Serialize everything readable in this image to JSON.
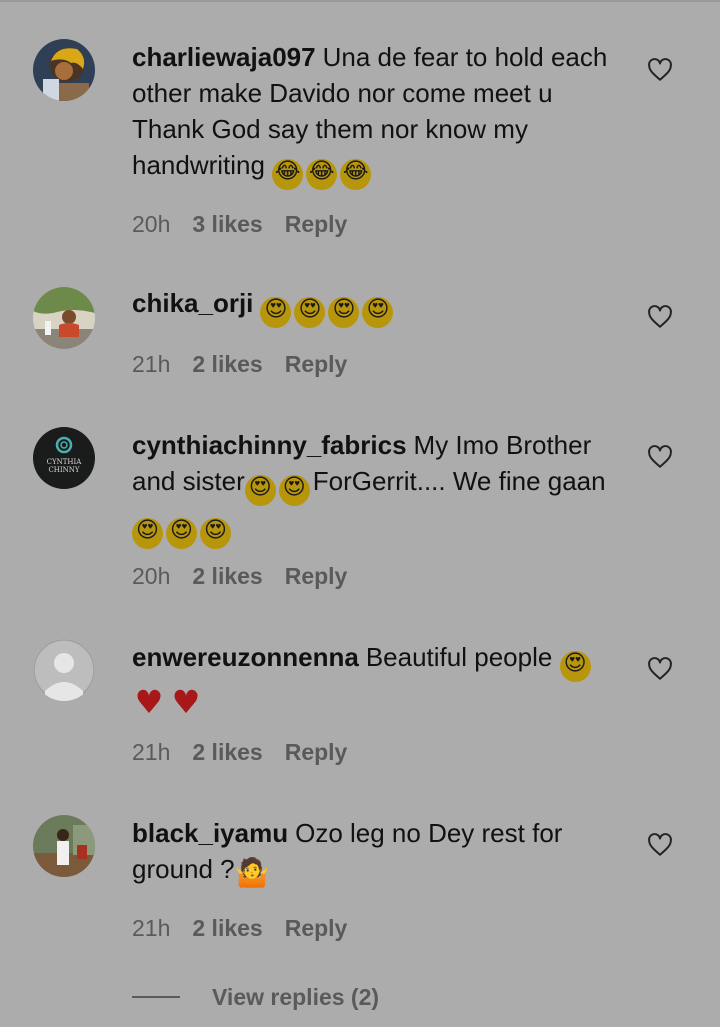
{
  "comments": [
    {
      "username": "charliewaja097",
      "text": "Una de fear to hold each other make Davido nor come meet u Thank God say them nor know my handwriting",
      "emojis": [
        "face-with-tears-of-joy",
        "face-with-tears-of-joy",
        "face-with-tears-of-joy"
      ],
      "time": "20h",
      "likes": "3 likes",
      "reply": "Reply"
    },
    {
      "username": "chika_orji",
      "text": "",
      "emojis": [
        "heart-eyes",
        "heart-eyes",
        "heart-eyes",
        "heart-eyes"
      ],
      "time": "21h",
      "likes": "2 likes",
      "reply": "Reply"
    },
    {
      "username": "cynthiachinny_fabrics",
      "text_part1": "My Imo Brother and sister",
      "text_part2": "ForGerrit.... We fine gaan",
      "avatar_text": "CYNTHIA CHINNY",
      "emojis": [
        "heart-eyes",
        "heart-eyes",
        "heart-eyes",
        "heart-eyes",
        "heart-eyes"
      ],
      "time": "20h",
      "likes": "2 likes",
      "reply": "Reply"
    },
    {
      "username": "enwereuzonnenna",
      "text": "Beautiful people",
      "emojis": [
        "heart-eyes",
        "red-heart",
        "red-heart"
      ],
      "time": "21h",
      "likes": "2 likes",
      "reply": "Reply"
    },
    {
      "username": "black_iyamu",
      "text": "Ozo leg no Dey rest for ground ?",
      "emojis": [
        "person-shrugging"
      ],
      "time": "21h",
      "likes": "2 likes",
      "reply": "Reply"
    }
  ],
  "view_replies": "View replies (2)",
  "colors": {
    "background": "#acacac",
    "text": "#111111",
    "meta": "#5a5a5a",
    "emoji_face": "#b8960c",
    "heart_red": "#a81818"
  },
  "icons": {
    "like": "heart-outline-icon"
  }
}
